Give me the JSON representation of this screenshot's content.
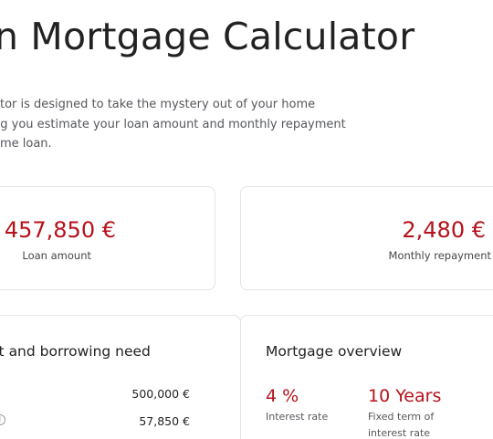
{
  "header": {
    "title": "n Mortgage Calculator"
  },
  "intro": {
    "lines": [
      "ator is designed to take the mystery out of your home",
      "ng you estimate your loan amount and monthly repayment",
      "ome loan."
    ]
  },
  "summary": {
    "loan_amount": {
      "value": "457,850 €",
      "label": "Loan amount"
    },
    "monthly_repayment": {
      "value": "2,480 €",
      "label": "Monthly repayment"
    }
  },
  "cost_card": {
    "heading": "ost and borrowing need",
    "rows": [
      {
        "value": "500,000 €"
      },
      {
        "value": "57,850 €",
        "icon": "info-icon"
      }
    ]
  },
  "overview_card": {
    "heading": "Mortgage overview",
    "interest_rate": {
      "value": "4 %",
      "label": "Interest rate"
    },
    "fixed_term": {
      "value": "10 Years",
      "label_lines": [
        "Fixed term of",
        "interest rate"
      ]
    }
  },
  "colors": {
    "accent": "#b5121b",
    "text": "#222222",
    "muted": "#55575c",
    "border": "#e4e4e6"
  }
}
